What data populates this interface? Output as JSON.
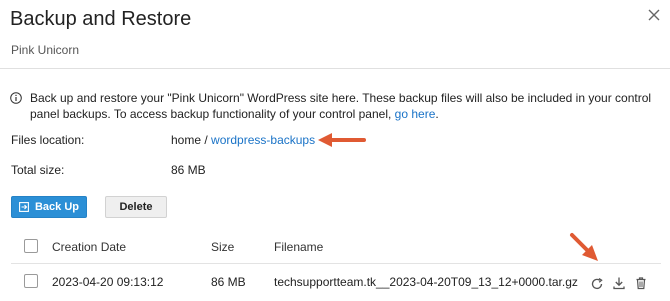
{
  "dialog": {
    "title": "Backup and Restore",
    "subtitle": "Pink Unicorn"
  },
  "info": {
    "text_before": "Back up and restore your \"Pink Unicorn\" WordPress site here. These backup files will also be included in your control panel backups. To access backup functionality of your control panel, ",
    "link_label": "go here",
    "text_after": "."
  },
  "files_location": {
    "label": "Files location:",
    "root": "home",
    "separator": " / ",
    "folder_link": "wordpress-backups"
  },
  "total_size": {
    "label": "Total size:",
    "value": "86 MB"
  },
  "toolbar": {
    "backup_label": "Back Up",
    "delete_label": "Delete"
  },
  "table": {
    "columns": [
      "Creation Date",
      "Size",
      "Filename"
    ],
    "rows": [
      {
        "creation_date": "2023-04-20 09:13:12",
        "size": "86 MB",
        "filename": "techsupportteam.tk__2023-04-20T09_13_12+0000.tar.gz",
        "actions": [
          "restore-icon",
          "download-icon",
          "trash-icon"
        ]
      }
    ]
  },
  "colors": {
    "primary": "#2b8fd6",
    "link": "#1a73c7",
    "annotation_arrow": "#e05a33"
  }
}
